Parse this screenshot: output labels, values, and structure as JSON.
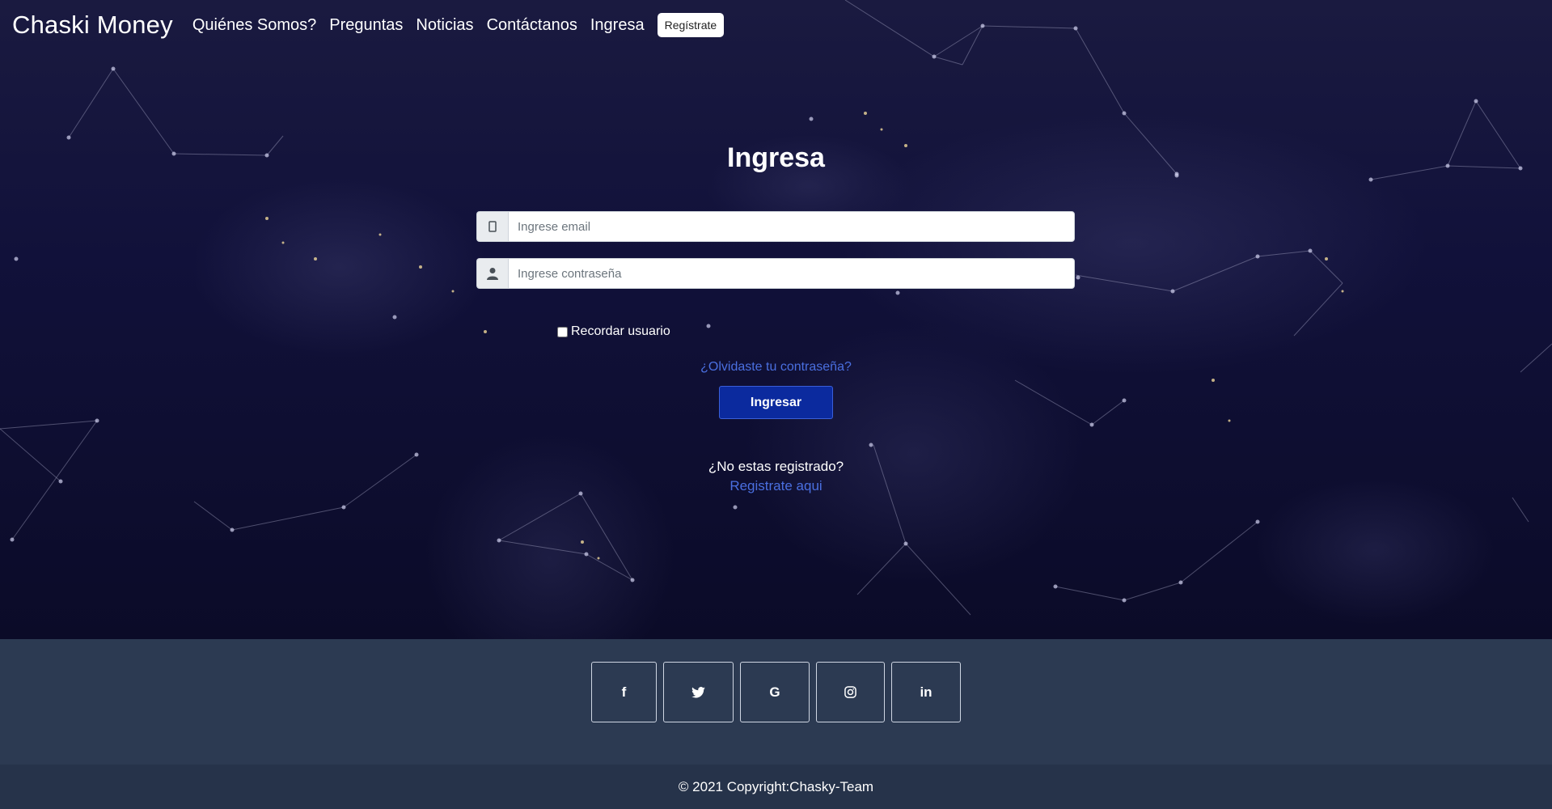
{
  "navbar": {
    "brand": "Chaski Money",
    "links": [
      "Quiénes Somos?",
      "Preguntas",
      "Noticias",
      "Contáctanos",
      "Ingresa"
    ],
    "register_button": "Regístrate"
  },
  "login": {
    "title": "Ingresa",
    "email_placeholder": "Ingrese email",
    "password_placeholder": "Ingrese contraseña",
    "remember_label": "Recordar usuario",
    "forgot_link": "¿Olvidaste tu contraseña?",
    "submit_label": "Ingresar",
    "no_account_text": "¿No estas registrado?",
    "register_link": "Registrate aqui"
  },
  "footer": {
    "social": [
      {
        "icon": "facebook-icon",
        "glyph": "f"
      },
      {
        "icon": "twitter-icon",
        "glyph": "🐦"
      },
      {
        "icon": "google-icon",
        "glyph": "G"
      },
      {
        "icon": "instagram-icon",
        "glyph": "◎"
      },
      {
        "icon": "linkedin-icon",
        "glyph": "in"
      }
    ],
    "copyright": "© 2021 Copyright:Chasky-Team"
  },
  "colors": {
    "background": "#0a0a2a",
    "accent_link": "#4a6fe0",
    "submit_button": "#0b2a9e",
    "footer": "#2c3a52",
    "copyright_bar": "#26334a"
  }
}
